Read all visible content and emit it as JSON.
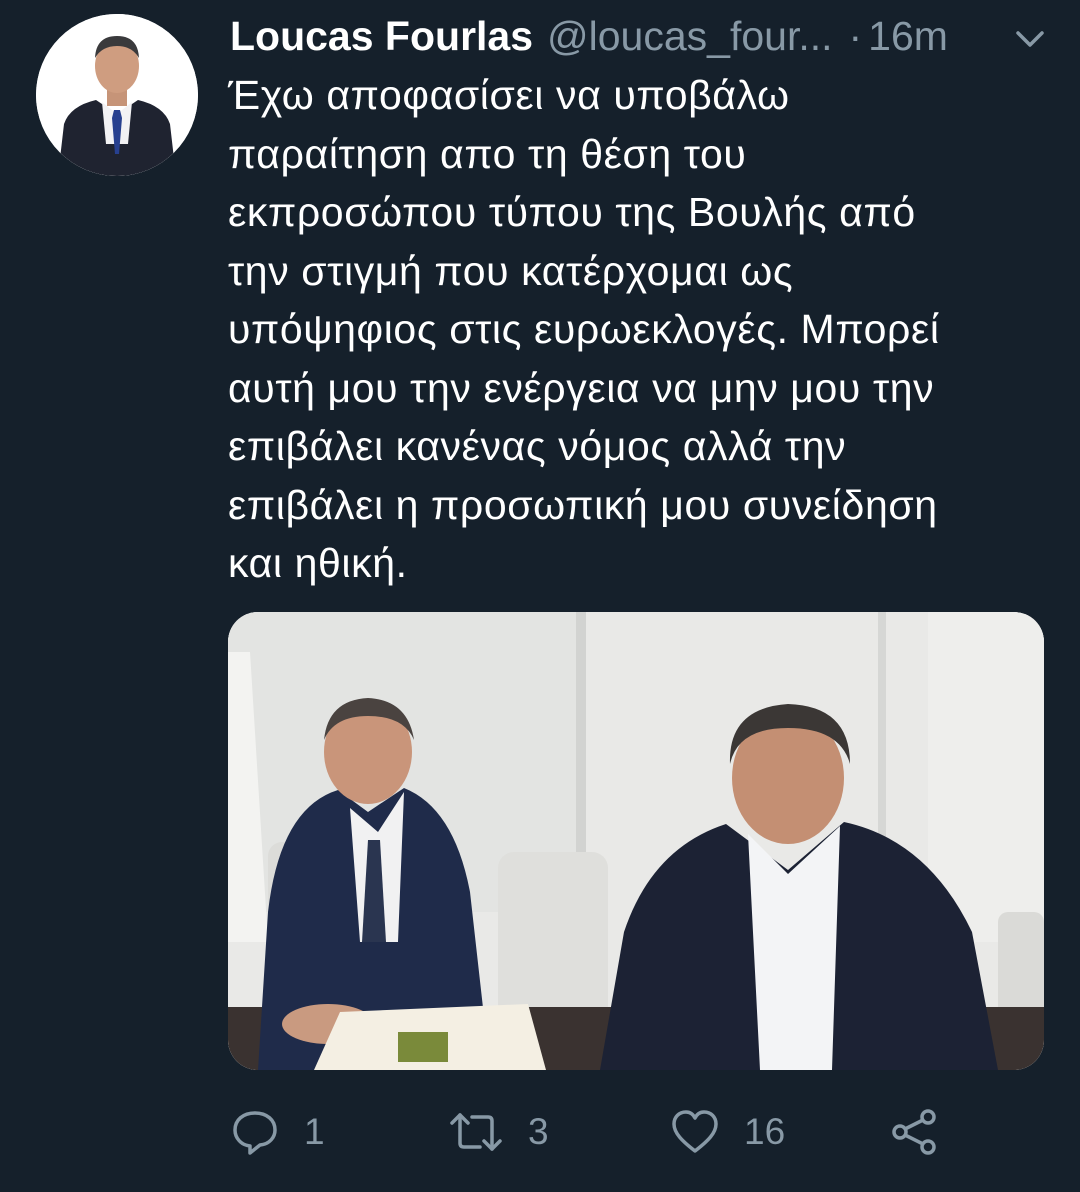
{
  "tweet": {
    "author_name": "Loucas Fourlas",
    "handle": "@loucas_four...",
    "separator": "·",
    "time": "16m",
    "text": "Έχω αποφασίσει να υποβάλω\nπαραίτηση απο τη θέση του\nεκπροσώπου τύπου της Βουλής από\nτην στιγμή που κατέρχομαι ως\nυπόψηφιος στις ευρωεκλογές. Μπορεί\nαυτή μου την ενέργεια να μην μου την\nεπιβάλει κανένας νόμος αλλά την\nεπιβάλει η προσωπική μου συνείδηση\nκαι ηθική.",
    "replies": "1",
    "retweets": "3",
    "likes": "16"
  },
  "icons": {
    "more": "chevron-down-icon",
    "reply": "reply-icon",
    "retweet": "retweet-icon",
    "like": "heart-icon",
    "share": "share-icon"
  },
  "colors": {
    "background": "#15202b",
    "text": "#ffffff",
    "secondary": "#8899a6"
  }
}
